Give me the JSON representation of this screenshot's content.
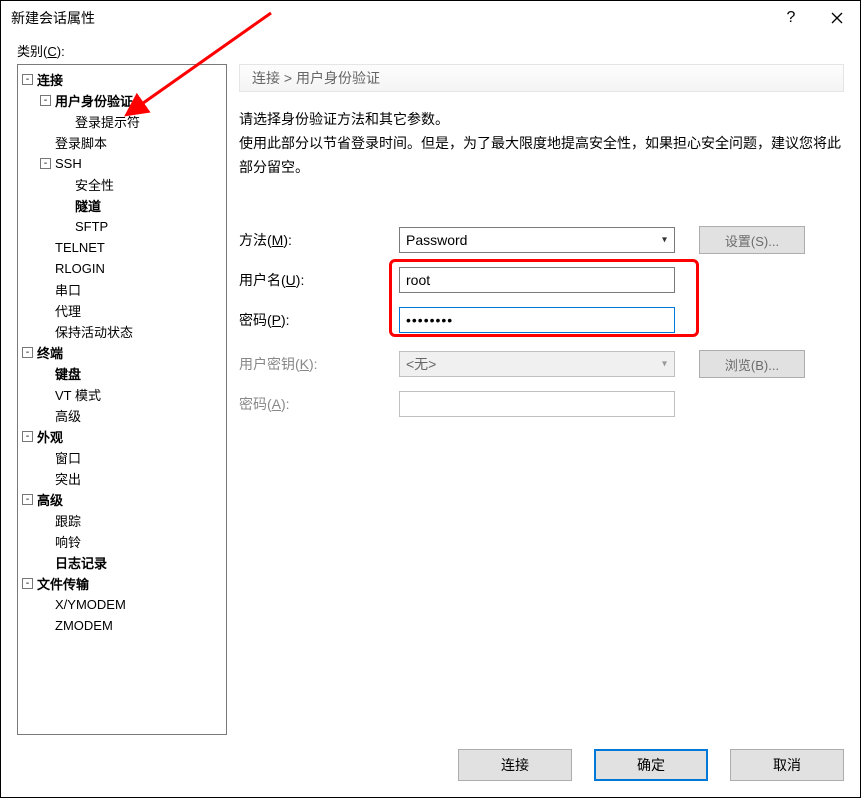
{
  "window": {
    "title": "新建会话属性"
  },
  "category_label": "类别",
  "category_hotkey": "C",
  "tree": {
    "connect": "连接",
    "auth": "用户身份验证",
    "login_prompt": "登录提示符",
    "login_script": "登录脚本",
    "ssh": "SSH",
    "security": "安全性",
    "tunnel": "隧道",
    "sftp": "SFTP",
    "telnet": "TELNET",
    "rlogin": "RLOGIN",
    "serial": "串口",
    "proxy": "代理",
    "keepalive": "保持活动状态",
    "terminal": "终端",
    "keyboard": "键盘",
    "vt": "VT 模式",
    "advanced_t": "高级",
    "appearance": "外观",
    "window_i": "窗口",
    "highlight": "突出",
    "advanced": "高级",
    "trace": "跟踪",
    "bell": "响铃",
    "logging": "日志记录",
    "filetransfer": "文件传输",
    "xymodem": "X/YMODEM",
    "zmodem": "ZMODEM"
  },
  "breadcrumb": "连接 > 用户身份验证",
  "instructions": {
    "line1": "请选择身份验证方法和其它参数。",
    "line2": "使用此部分以节省登录时间。但是，为了最大限度地提高安全性，如果担心安全问题，建议您将此部分留空。"
  },
  "labels": {
    "method": "方法",
    "method_k": "M",
    "username": "用户名",
    "username_k": "U",
    "password": "密码",
    "password_k": "P",
    "userkey": "用户密钥",
    "userkey_k": "K",
    "password2": "密码",
    "password2_k": "A"
  },
  "values": {
    "method": "Password",
    "username": "root",
    "password": "••••••••",
    "userkey": "<无>",
    "password2": ""
  },
  "buttons": {
    "settings": "设置(S)...",
    "browse": "浏览(B)...",
    "connect": "连接",
    "ok": "确定",
    "cancel": "取消"
  }
}
